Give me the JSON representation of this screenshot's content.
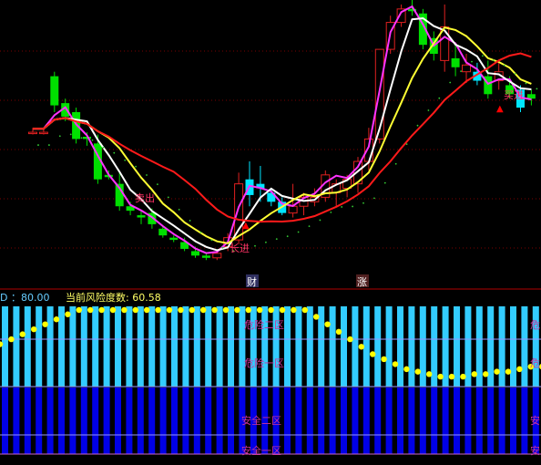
{
  "colors": {
    "background": "#000000",
    "grid_dotted": "#7a0000",
    "separator": "#a00000",
    "candle_up": "#e02020",
    "candle_down_cyan": "#00e5ff",
    "candle_down_green": "#00e000",
    "ma_white": "#ffffff",
    "ma_magenta": "#ff33ff",
    "ma_yellow": "#ffff33",
    "ma_red": "#ff1a1a",
    "signal_label": "#ff3366",
    "risk_title": "#ffff66",
    "risk_prefix": "#66ccff",
    "zone_light": "#33ccff",
    "zone_dark": "#0000e6",
    "zone_label": "#cc3399"
  },
  "signals": [
    {
      "text": "卖出",
      "marker": "▲"
    },
    {
      "text": "长进",
      "marker": "▲"
    },
    {
      "text": "买进",
      "marker": "▲"
    }
  ],
  "badges": {
    "cai": "财",
    "zhang": "涨"
  },
  "risk_panel": {
    "prefix_value": "D ：80.00",
    "title": "当前风险度数: 60.58",
    "zones": {
      "danger_2": "危险二区",
      "danger_1": "危险一区",
      "safe_2": "安全二区",
      "safe_1": "安全一区"
    },
    "right_edge_labels": {
      "danger_2": "危",
      "danger_1": "危",
      "safe_2": "安",
      "safe_1": "安"
    }
  },
  "chart_data": [
    {
      "type": "candlestick",
      "title": "",
      "xlabel": "",
      "ylabel": "",
      "ohlc": [
        {
          "o": 3,
          "h": 5,
          "l": 2,
          "c": 3
        },
        {
          "o": 3,
          "h": 5,
          "l": 2,
          "c": 3
        },
        {
          "o": 28,
          "h": 30,
          "l": 12,
          "c": 15
        },
        {
          "o": 16,
          "h": 18,
          "l": 8,
          "c": 10
        },
        {
          "o": 12,
          "h": 14,
          "l": -2,
          "c": 0
        },
        {
          "o": 1,
          "h": 3,
          "l": -3,
          "c": 0
        },
        {
          "o": -2,
          "h": 2,
          "l": -20,
          "c": -18
        },
        {
          "o": -16,
          "h": -14,
          "l": -18,
          "c": -17
        },
        {
          "o": -20,
          "h": -15,
          "l": -32,
          "c": -30
        },
        {
          "o": -30,
          "h": -28,
          "l": -34,
          "c": -32
        },
        {
          "o": -34,
          "h": -32,
          "l": -38,
          "c": -35
        },
        {
          "o": -33,
          "h": -31,
          "l": -40,
          "c": -38
        },
        {
          "o": -40,
          "h": -39,
          "l": -44,
          "c": -43
        },
        {
          "o": -44,
          "h": -43,
          "l": -46,
          "c": -45
        },
        {
          "o": -46,
          "h": -44,
          "l": -50,
          "c": -49
        },
        {
          "o": -50,
          "h": -48,
          "l": -53,
          "c": -52
        },
        {
          "o": -52,
          "h": -51,
          "l": -54,
          "c": -53
        },
        {
          "o": -53,
          "h": -50,
          "l": -54,
          "c": -51
        },
        {
          "o": -48,
          "h": -42,
          "l": -50,
          "c": -44
        },
        {
          "o": -45,
          "h": -15,
          "l": -47,
          "c": -20
        },
        {
          "o": -18,
          "h": -10,
          "l": -30,
          "c": -25
        },
        {
          "o": -20,
          "h": -12,
          "l": -28,
          "c": -22
        },
        {
          "o": -24,
          "h": -22,
          "l": -30,
          "c": -28
        },
        {
          "o": -28,
          "h": -26,
          "l": -34,
          "c": -33
        },
        {
          "o": -33,
          "h": -20,
          "l": -35,
          "c": -30
        },
        {
          "o": -30,
          "h": -24,
          "l": -34,
          "c": -26
        },
        {
          "o": -28,
          "h": -22,
          "l": -30,
          "c": -26
        },
        {
          "o": -26,
          "h": -14,
          "l": -28,
          "c": -16
        },
        {
          "o": -24,
          "h": -18,
          "l": -30,
          "c": -20
        },
        {
          "o": -22,
          "h": -16,
          "l": -26,
          "c": -18
        },
        {
          "o": -20,
          "h": -8,
          "l": -24,
          "c": -10
        },
        {
          "o": -10,
          "h": 5,
          "l": -14,
          "c": 0
        },
        {
          "o": 0,
          "h": 40,
          "l": -2,
          "c": 40
        },
        {
          "o": 40,
          "h": 55,
          "l": 38,
          "c": 52
        },
        {
          "o": 52,
          "h": 60,
          "l": 50,
          "c": 58
        },
        {
          "o": 58,
          "h": 62,
          "l": 55,
          "c": 57
        },
        {
          "o": 56,
          "h": 58,
          "l": 40,
          "c": 42
        },
        {
          "o": 45,
          "h": 48,
          "l": 35,
          "c": 38
        },
        {
          "o": 35,
          "h": 60,
          "l": 30,
          "c": 50
        },
        {
          "o": 36,
          "h": 42,
          "l": 28,
          "c": 32
        },
        {
          "o": 30,
          "h": 38,
          "l": 25,
          "c": 33
        },
        {
          "o": 30,
          "h": 34,
          "l": 24,
          "c": 26
        },
        {
          "o": 28,
          "h": 35,
          "l": 18,
          "c": 20
        },
        {
          "o": 26,
          "h": 35,
          "l": 22,
          "c": 30
        },
        {
          "o": 24,
          "h": 28,
          "l": 18,
          "c": 20
        },
        {
          "o": 22,
          "h": 24,
          "l": 12,
          "c": 14
        },
        {
          "o": 20,
          "h": 22,
          "l": 15,
          "c": 18
        }
      ]
    },
    {
      "type": "bar",
      "title": "",
      "xlabel": "",
      "ylabel": "",
      "series": [
        {
          "values": [
            52,
            54,
            56,
            58,
            60,
            62,
            64,
            66,
            67,
            68,
            69,
            70,
            71,
            72,
            72,
            73,
            73,
            74,
            74,
            74,
            74,
            73,
            73,
            72,
            71,
            70,
            68,
            66,
            63,
            60,
            57,
            54,
            51,
            48,
            46,
            44,
            42,
            41,
            40,
            39,
            39,
            39,
            40,
            40,
            41,
            41,
            42,
            43,
            43
          ]
        }
      ]
    }
  ]
}
